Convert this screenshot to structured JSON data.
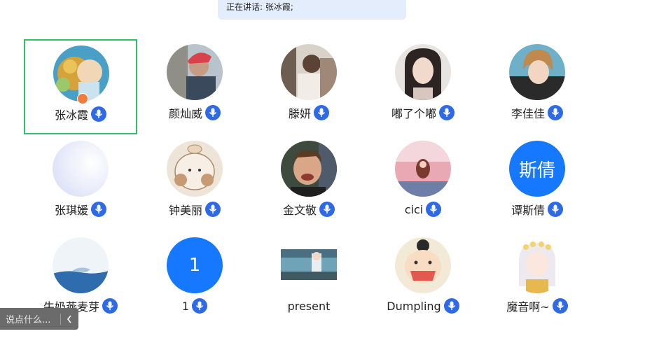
{
  "speaking": {
    "label": "正在讲话: 张冰霞;"
  },
  "participants": [
    {
      "name": "张冰霞",
      "avatar": "photo",
      "active": true
    },
    {
      "name": "颜灿威",
      "avatar": "photo"
    },
    {
      "name": "滕妍",
      "avatar": "photo"
    },
    {
      "name": "嘟了个嘟",
      "avatar": "photo"
    },
    {
      "name": "李佳佳",
      "avatar": "photo"
    },
    {
      "name": "张琪媛",
      "avatar": "photo"
    },
    {
      "name": "钟美丽",
      "avatar": "photo"
    },
    {
      "name": "金文敬",
      "avatar": "photo"
    },
    {
      "name": "cici",
      "avatar": "photo"
    },
    {
      "name": "谭斯倩",
      "avatar": "text",
      "avatar_text": "斯倩"
    },
    {
      "name": "牛奶燕麦芽",
      "avatar": "photo"
    },
    {
      "name": "1",
      "avatar": "text",
      "avatar_text": "1"
    },
    {
      "name": "present",
      "avatar": "photo"
    },
    {
      "name": "Dumpling",
      "avatar": "photo"
    },
    {
      "name": "魔音啊~",
      "avatar": "photo"
    }
  ],
  "chat": {
    "placeholder": "说点什么..."
  },
  "colors": {
    "accent": "#1677ff",
    "mic": "#2f6ae6",
    "active_border": "#2ec26a",
    "host_badge": "#f07d3c"
  },
  "icons": [
    "microphone-icon",
    "host-icon",
    "chevron-left-icon"
  ]
}
